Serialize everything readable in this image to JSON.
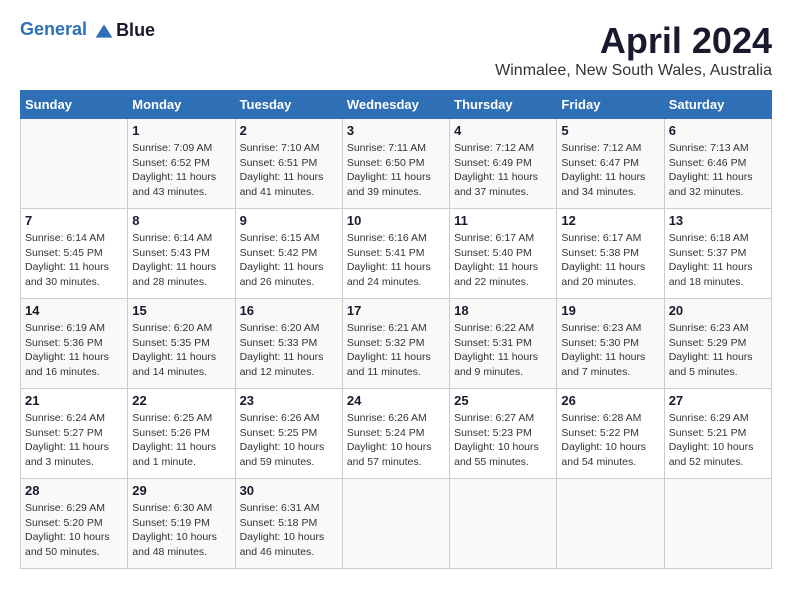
{
  "header": {
    "logo_line1": "General",
    "logo_line2": "Blue",
    "month": "April 2024",
    "location": "Winmalee, New South Wales, Australia"
  },
  "days_of_week": [
    "Sunday",
    "Monday",
    "Tuesday",
    "Wednesday",
    "Thursday",
    "Friday",
    "Saturday"
  ],
  "weeks": [
    [
      {
        "day": "",
        "sunrise": "",
        "sunset": "",
        "daylight": ""
      },
      {
        "day": "1",
        "sunrise": "Sunrise: 7:09 AM",
        "sunset": "Sunset: 6:52 PM",
        "daylight": "Daylight: 11 hours and 43 minutes."
      },
      {
        "day": "2",
        "sunrise": "Sunrise: 7:10 AM",
        "sunset": "Sunset: 6:51 PM",
        "daylight": "Daylight: 11 hours and 41 minutes."
      },
      {
        "day": "3",
        "sunrise": "Sunrise: 7:11 AM",
        "sunset": "Sunset: 6:50 PM",
        "daylight": "Daylight: 11 hours and 39 minutes."
      },
      {
        "day": "4",
        "sunrise": "Sunrise: 7:12 AM",
        "sunset": "Sunset: 6:49 PM",
        "daylight": "Daylight: 11 hours and 37 minutes."
      },
      {
        "day": "5",
        "sunrise": "Sunrise: 7:12 AM",
        "sunset": "Sunset: 6:47 PM",
        "daylight": "Daylight: 11 hours and 34 minutes."
      },
      {
        "day": "6",
        "sunrise": "Sunrise: 7:13 AM",
        "sunset": "Sunset: 6:46 PM",
        "daylight": "Daylight: 11 hours and 32 minutes."
      }
    ],
    [
      {
        "day": "7",
        "sunrise": "Sunrise: 6:14 AM",
        "sunset": "Sunset: 5:45 PM",
        "daylight": "Daylight: 11 hours and 30 minutes."
      },
      {
        "day": "8",
        "sunrise": "Sunrise: 6:14 AM",
        "sunset": "Sunset: 5:43 PM",
        "daylight": "Daylight: 11 hours and 28 minutes."
      },
      {
        "day": "9",
        "sunrise": "Sunrise: 6:15 AM",
        "sunset": "Sunset: 5:42 PM",
        "daylight": "Daylight: 11 hours and 26 minutes."
      },
      {
        "day": "10",
        "sunrise": "Sunrise: 6:16 AM",
        "sunset": "Sunset: 5:41 PM",
        "daylight": "Daylight: 11 hours and 24 minutes."
      },
      {
        "day": "11",
        "sunrise": "Sunrise: 6:17 AM",
        "sunset": "Sunset: 5:40 PM",
        "daylight": "Daylight: 11 hours and 22 minutes."
      },
      {
        "day": "12",
        "sunrise": "Sunrise: 6:17 AM",
        "sunset": "Sunset: 5:38 PM",
        "daylight": "Daylight: 11 hours and 20 minutes."
      },
      {
        "day": "13",
        "sunrise": "Sunrise: 6:18 AM",
        "sunset": "Sunset: 5:37 PM",
        "daylight": "Daylight: 11 hours and 18 minutes."
      }
    ],
    [
      {
        "day": "14",
        "sunrise": "Sunrise: 6:19 AM",
        "sunset": "Sunset: 5:36 PM",
        "daylight": "Daylight: 11 hours and 16 minutes."
      },
      {
        "day": "15",
        "sunrise": "Sunrise: 6:20 AM",
        "sunset": "Sunset: 5:35 PM",
        "daylight": "Daylight: 11 hours and 14 minutes."
      },
      {
        "day": "16",
        "sunrise": "Sunrise: 6:20 AM",
        "sunset": "Sunset: 5:33 PM",
        "daylight": "Daylight: 11 hours and 12 minutes."
      },
      {
        "day": "17",
        "sunrise": "Sunrise: 6:21 AM",
        "sunset": "Sunset: 5:32 PM",
        "daylight": "Daylight: 11 hours and 11 minutes."
      },
      {
        "day": "18",
        "sunrise": "Sunrise: 6:22 AM",
        "sunset": "Sunset: 5:31 PM",
        "daylight": "Daylight: 11 hours and 9 minutes."
      },
      {
        "day": "19",
        "sunrise": "Sunrise: 6:23 AM",
        "sunset": "Sunset: 5:30 PM",
        "daylight": "Daylight: 11 hours and 7 minutes."
      },
      {
        "day": "20",
        "sunrise": "Sunrise: 6:23 AM",
        "sunset": "Sunset: 5:29 PM",
        "daylight": "Daylight: 11 hours and 5 minutes."
      }
    ],
    [
      {
        "day": "21",
        "sunrise": "Sunrise: 6:24 AM",
        "sunset": "Sunset: 5:27 PM",
        "daylight": "Daylight: 11 hours and 3 minutes."
      },
      {
        "day": "22",
        "sunrise": "Sunrise: 6:25 AM",
        "sunset": "Sunset: 5:26 PM",
        "daylight": "Daylight: 11 hours and 1 minute."
      },
      {
        "day": "23",
        "sunrise": "Sunrise: 6:26 AM",
        "sunset": "Sunset: 5:25 PM",
        "daylight": "Daylight: 10 hours and 59 minutes."
      },
      {
        "day": "24",
        "sunrise": "Sunrise: 6:26 AM",
        "sunset": "Sunset: 5:24 PM",
        "daylight": "Daylight: 10 hours and 57 minutes."
      },
      {
        "day": "25",
        "sunrise": "Sunrise: 6:27 AM",
        "sunset": "Sunset: 5:23 PM",
        "daylight": "Daylight: 10 hours and 55 minutes."
      },
      {
        "day": "26",
        "sunrise": "Sunrise: 6:28 AM",
        "sunset": "Sunset: 5:22 PM",
        "daylight": "Daylight: 10 hours and 54 minutes."
      },
      {
        "day": "27",
        "sunrise": "Sunrise: 6:29 AM",
        "sunset": "Sunset: 5:21 PM",
        "daylight": "Daylight: 10 hours and 52 minutes."
      }
    ],
    [
      {
        "day": "28",
        "sunrise": "Sunrise: 6:29 AM",
        "sunset": "Sunset: 5:20 PM",
        "daylight": "Daylight: 10 hours and 50 minutes."
      },
      {
        "day": "29",
        "sunrise": "Sunrise: 6:30 AM",
        "sunset": "Sunset: 5:19 PM",
        "daylight": "Daylight: 10 hours and 48 minutes."
      },
      {
        "day": "30",
        "sunrise": "Sunrise: 6:31 AM",
        "sunset": "Sunset: 5:18 PM",
        "daylight": "Daylight: 10 hours and 46 minutes."
      },
      {
        "day": "",
        "sunrise": "",
        "sunset": "",
        "daylight": ""
      },
      {
        "day": "",
        "sunrise": "",
        "sunset": "",
        "daylight": ""
      },
      {
        "day": "",
        "sunrise": "",
        "sunset": "",
        "daylight": ""
      },
      {
        "day": "",
        "sunrise": "",
        "sunset": "",
        "daylight": ""
      }
    ]
  ]
}
